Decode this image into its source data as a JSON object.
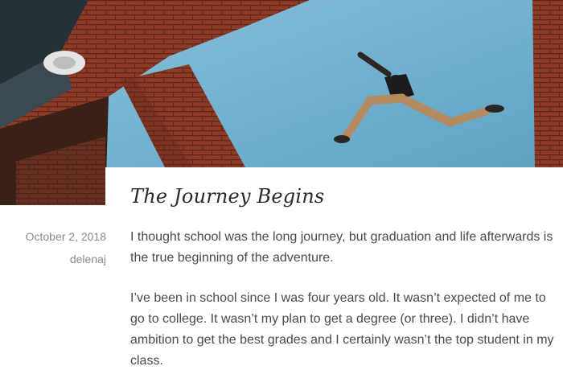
{
  "post": {
    "title": "The Journey Begins",
    "date": "October 2, 2018",
    "author": "delenaj",
    "paragraphs": [
      "I thought school was the long journey, but graduation and life afterwards is the true beginning of the adventure.",
      "I’ve been in school since I was four years old. It wasn’t expected of me to go to college. It wasn’t my plan to get a degree (or three). I didn’t have ambition to get the best grades and I certainly wasn’t the top student in my class."
    ]
  },
  "colors": {
    "sky": "#72b2d0",
    "brick": "#8a3a26",
    "text": "#4a4a4a",
    "meta": "#8a8a8a"
  }
}
